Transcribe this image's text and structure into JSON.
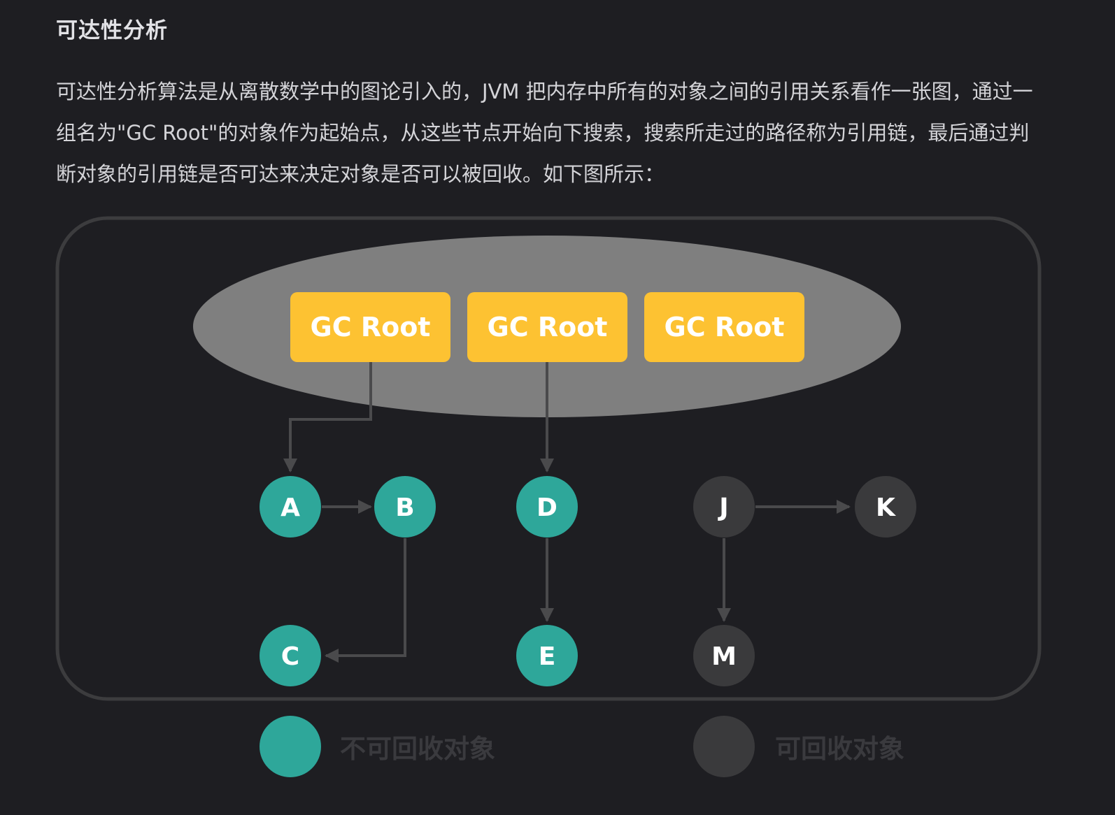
{
  "heading": "可达性分析",
  "paragraph": "可达性分析算法是从离散数学中的图论引入的，JVM 把内存中所有的对象之间的引用关系看作一张图，通过一组名为\"GC Root\"的对象作为起始点，从这些节点开始向下搜索，搜索所走过的路径称为引用链，最后通过判断对象的引用链是否可达来决定对象是否可以被回收。如下图所示：",
  "diagram": {
    "roots": [
      "GC Root",
      "GC Root",
      "GC Root"
    ],
    "nodes": {
      "a": "A",
      "b": "B",
      "c": "C",
      "d": "D",
      "e": "E",
      "j": "J",
      "k": "K",
      "m": "M"
    },
    "legend": {
      "reachable": "不可回收对象",
      "unreachable": "可回收对象"
    },
    "colors": {
      "reachable": "#2ea79a",
      "unreachable": "#3a3a3c",
      "root": "#fdc232",
      "ellipse": "#7f7f7f",
      "edge": "#4a4a4c",
      "frame": "#3c3c3e"
    }
  }
}
